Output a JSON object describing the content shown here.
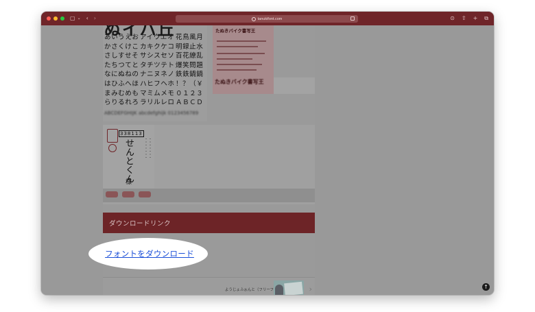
{
  "browser": {
    "url": "tanukifont.com",
    "colors": {
      "titlebar": "#6f2529",
      "overlay": "#9a9a9a"
    },
    "icons": [
      "sidebar-icon",
      "back-icon",
      "forward-icon",
      "share-icon",
      "new-tab-icon",
      "tabs-icon",
      "download-icon"
    ]
  },
  "samples": {
    "big_row": "ぬイハ丘",
    "kana_rows": [
      [
        "あいうえお",
        "アイウエオ",
        "花鳥風月"
      ],
      [
        "かさくけこ",
        "カキクケコ",
        "明録止水"
      ],
      [
        "さしすせそ",
        "サシスセソ",
        "百花繚乱"
      ],
      [
        "たちつてと",
        "タチツテト",
        "爆笑問題"
      ],
      [
        "なにぬねの",
        "ナニヌネノ",
        "鉄鉄鍋鍋"
      ],
      [
        "はひふへほ",
        "ハヒフヘホ",
        "！？（￥"
      ],
      [
        "まみむめも",
        "マミムメモ",
        "０１２３"
      ],
      [
        "らりるれろ",
        "ラリルレロ",
        "ＡＢＣＤ"
      ]
    ],
    "blur_row": "ABCDEFGHIJK abcdefghijk 0123456789",
    "photo_title": "たぬきバイク書写王",
    "photo_bottom": "たぬきバイク書写王"
  },
  "card2": {
    "header": "338113",
    "name": "せんとくん",
    "honorific": "様"
  },
  "download": {
    "section_title": "ダウンロードリンク",
    "link_label": "フォントをダウンロード",
    "link_color": "#1a4ed8",
    "section_color": "#6d2427"
  },
  "related": {
    "label": "ようじょふぉんと（フリーフォント）"
  }
}
